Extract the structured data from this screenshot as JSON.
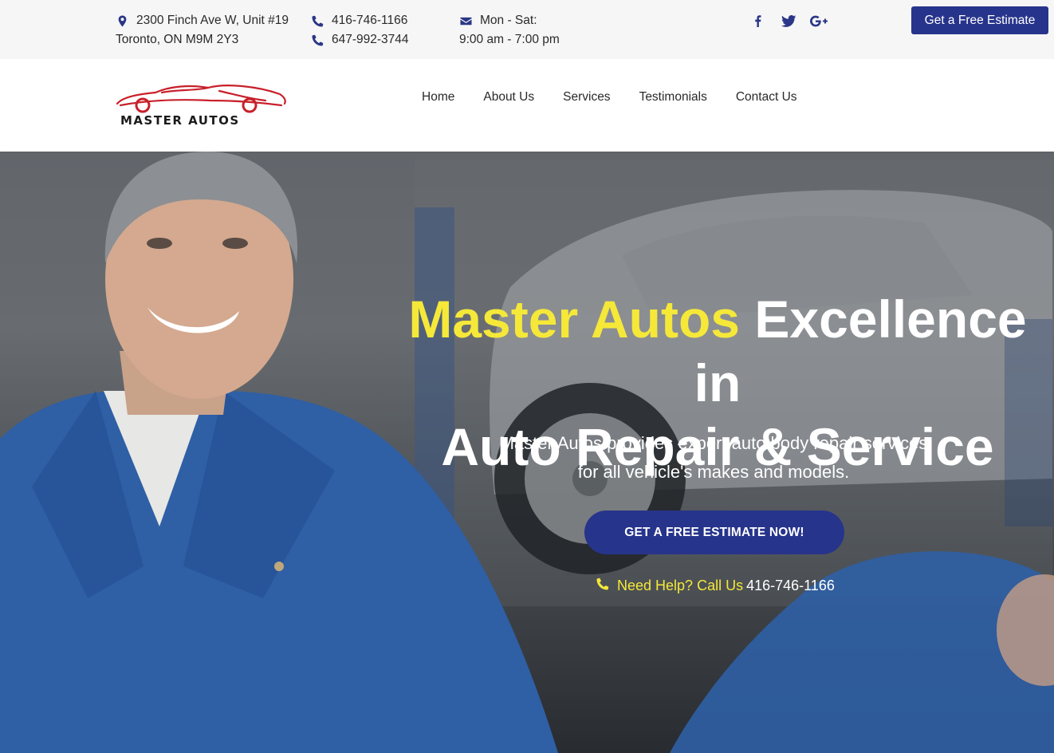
{
  "topbar": {
    "address_line1": "2300 Finch Ave W, Unit #19",
    "address_line2": "Toronto, ON M9M 2Y3",
    "phone1": "416-746-1166",
    "phone2": "647-992-3744",
    "hours_line1": "Mon - Sat:",
    "hours_line2": "9:00 am - 7:00 pm",
    "social": [
      "facebook-icon",
      "twitter-icon",
      "google-plus-icon"
    ],
    "estimate_button": "Get a Free Estimate"
  },
  "logo": {
    "text": "MASTER AUTOS"
  },
  "nav": {
    "items": [
      "Home",
      "About Us",
      "Services",
      "Testimonials",
      "Contact Us"
    ]
  },
  "hero": {
    "headline_highlight": "Master Autos",
    "headline_rest_line1": " Excellence in",
    "headline_line2": "Auto Repair & Service",
    "subtext_line1": "Master Autos provides expert auto body repair services",
    "subtext_line2": "for all vehicle's makes and models.",
    "cta_label": "GET A FREE ESTIMATE NOW!",
    "help_label": "Need Help? Call Us",
    "help_phone": "416-746-1166"
  },
  "colors": {
    "brand_blue": "#27348b",
    "highlight_yellow": "#f5e839",
    "topbar_bg": "#f6f6f6",
    "logo_red": "#c8202a"
  }
}
